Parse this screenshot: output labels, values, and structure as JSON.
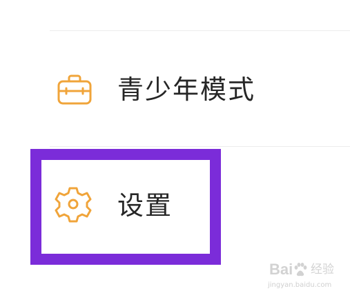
{
  "menu": {
    "items": [
      {
        "label": "青少年模式",
        "icon": "briefcase-icon"
      },
      {
        "label": "设置",
        "icon": "gear-icon"
      }
    ]
  },
  "highlight": {
    "color": "#7b2cd9"
  },
  "icon_color": "#f0a43a",
  "watermark": {
    "brand": "Bai",
    "suffix": "经验",
    "url": "jingyan.baidu.com"
  }
}
